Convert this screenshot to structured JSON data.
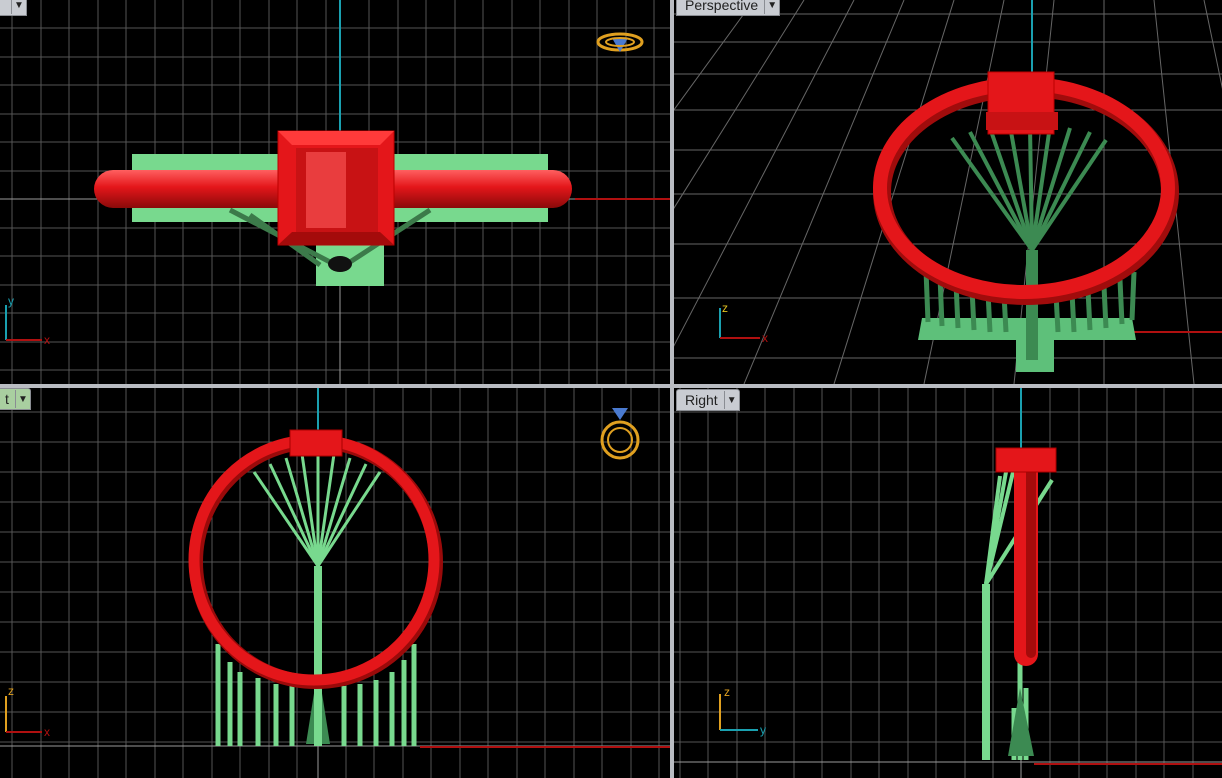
{
  "viewports": {
    "top": {
      "label": "",
      "active": false
    },
    "perspective": {
      "label": "Perspective",
      "active": false
    },
    "front": {
      "label": "t",
      "active": true
    },
    "right": {
      "label": "Right",
      "active": false
    }
  },
  "axes": {
    "top": {
      "vertical": "y",
      "horizontal": "x"
    },
    "perspective": {
      "vertical": "z",
      "horizontal": "x"
    },
    "front": {
      "vertical": "z",
      "horizontal": "x"
    },
    "right": {
      "vertical": "z",
      "horizontal": "y"
    }
  },
  "icons": {
    "top_widget": "ring-top-widget-icon",
    "front_widget": "ring-front-widget-icon",
    "tab_menu": "chevron-down-icon"
  },
  "colors": {
    "ring": "#e4161a",
    "supports": "#78d98e",
    "grid": "#5a5a5a",
    "grid_major": "#9a9a9a",
    "axis_red": "#b01010",
    "axis_cyan": "#1aa0b0",
    "widget_gold": "#e0a020"
  }
}
